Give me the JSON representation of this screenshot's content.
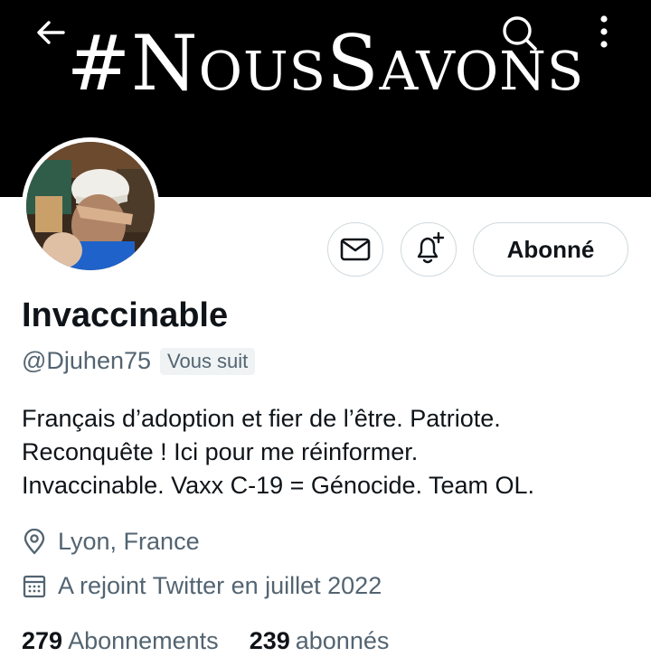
{
  "banner": {
    "text": "#NousSavons"
  },
  "toolbar": {
    "back_icon": "arrow-left-icon",
    "search_icon": "search-icon",
    "more_icon": "more-vertical-icon"
  },
  "actions": {
    "message_icon": "envelope-icon",
    "notify_icon": "bell-plus-icon",
    "follow_label": "Abonné"
  },
  "profile": {
    "name": "Invaccinable",
    "handle": "@Djuhen75",
    "follows_you": "Vous suit",
    "bio": [
      "Français d’adoption et fier de l’être. Patriote.",
      "Reconquête ! Ici pour me réinformer.",
      "Invaccinable. Vaxx C-19 = Génocide. Team OL."
    ],
    "location": "Lyon, France",
    "joined": "A rejoint Twitter en juillet 2022"
  },
  "stats": {
    "following_count": "279",
    "following_label": "Abonnements",
    "followers_count": "239",
    "followers_label": "abonnés"
  },
  "colors": {
    "text": "#0f1419",
    "secondary": "#536471",
    "border": "#cfd9de",
    "banner": "#000000"
  }
}
